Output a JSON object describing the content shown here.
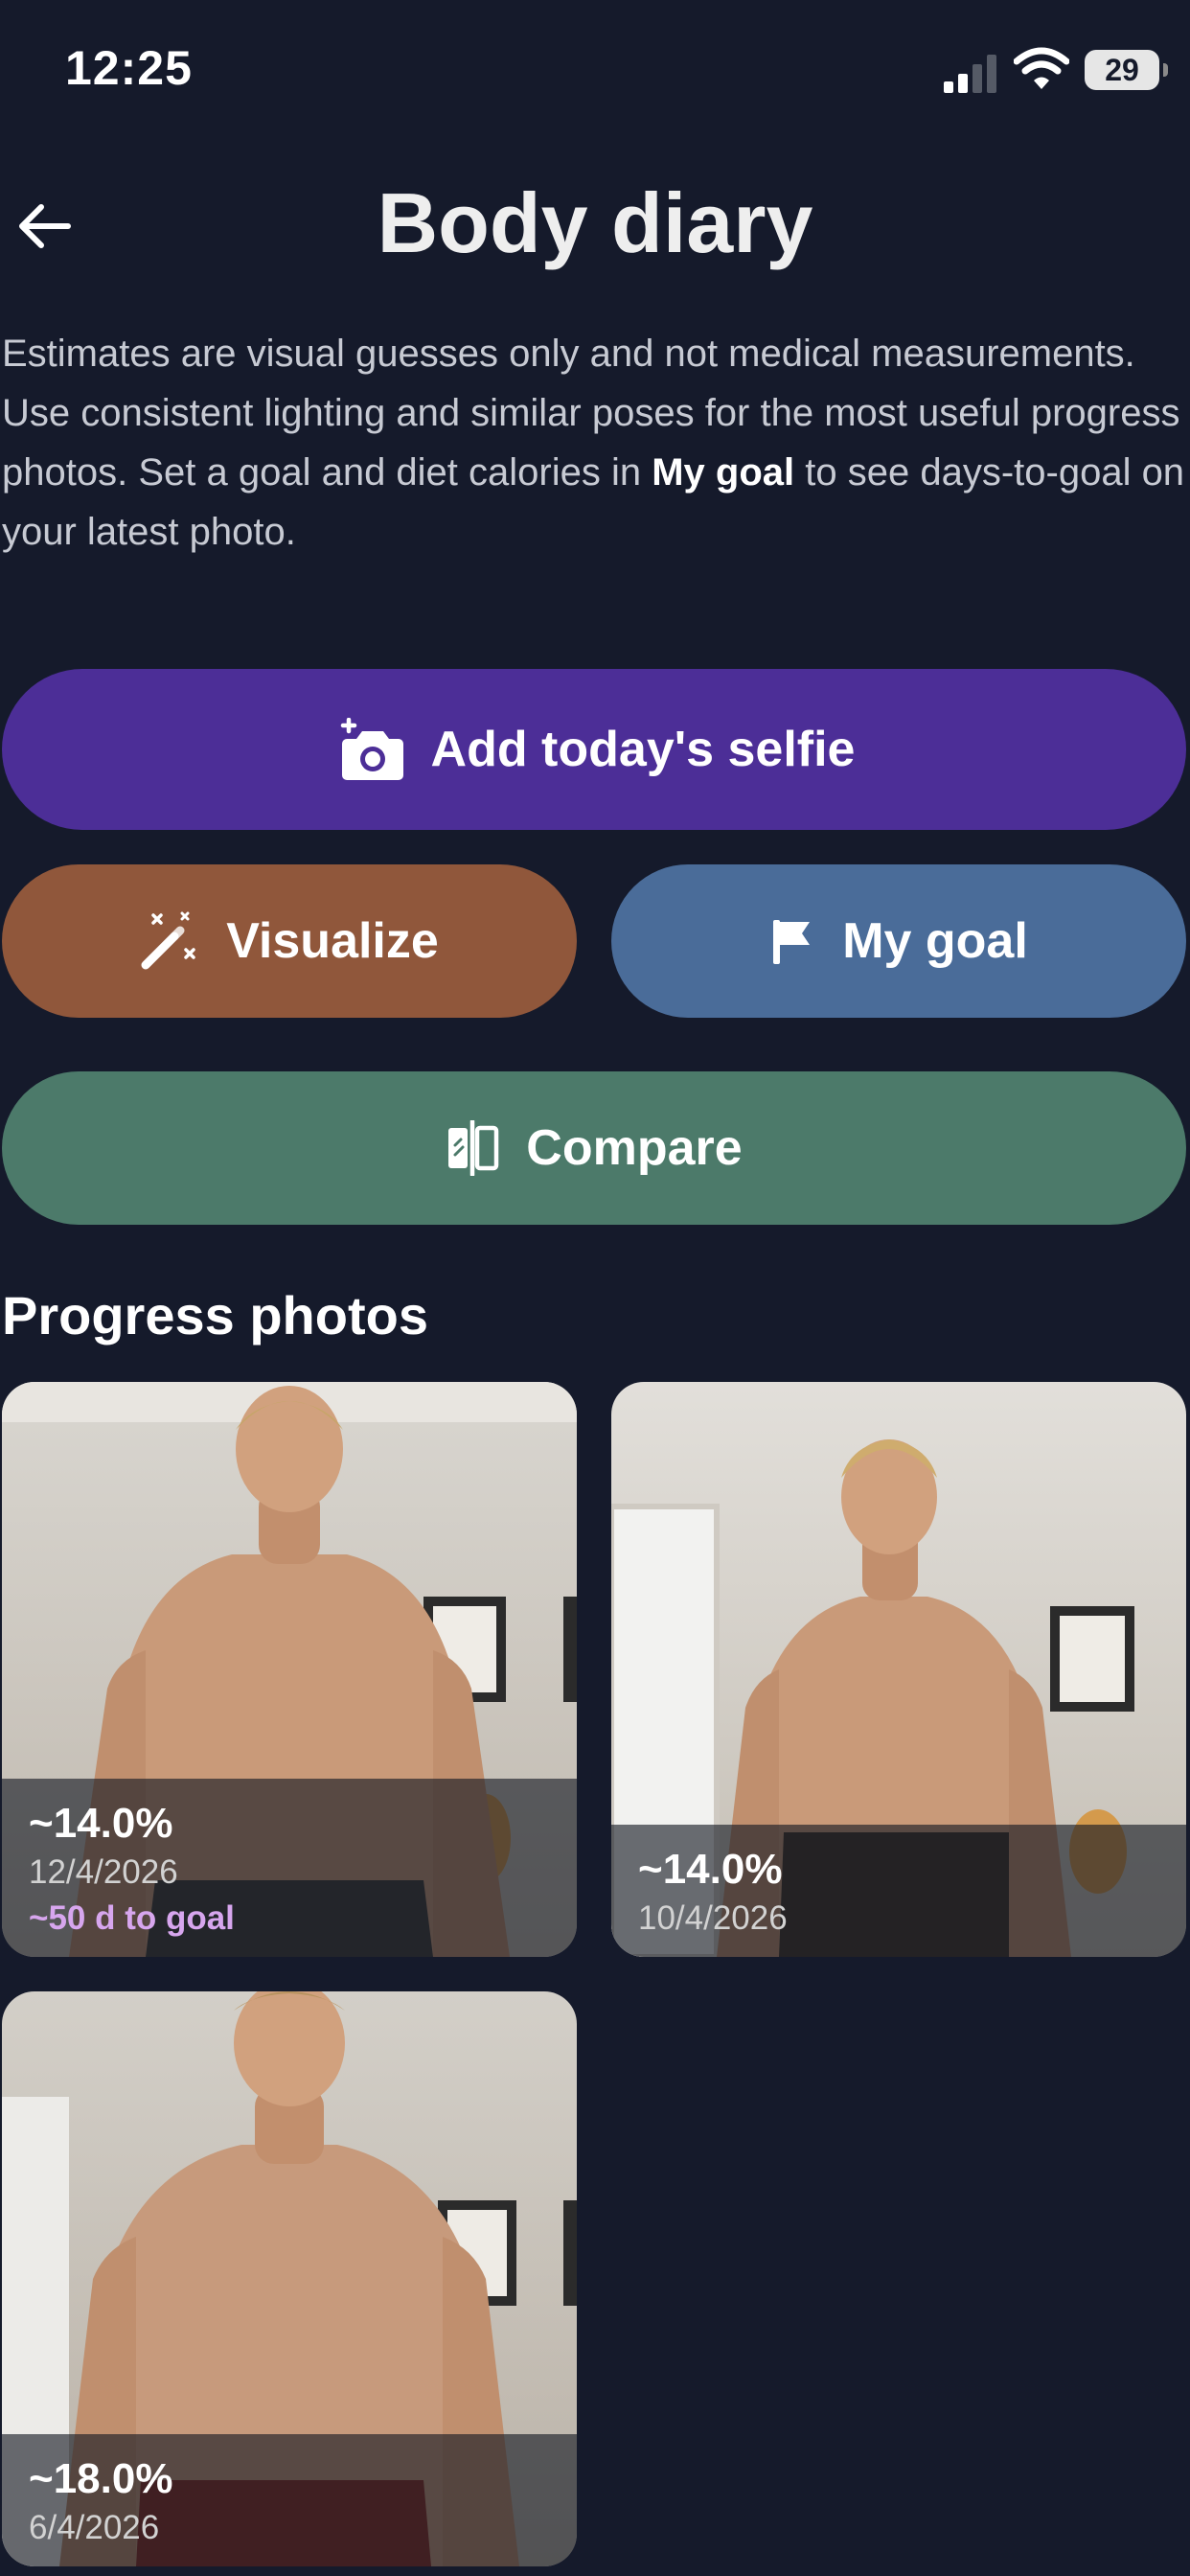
{
  "status_bar": {
    "time": "12:25",
    "battery": "29",
    "icons": [
      "signal-icon",
      "wifi-icon",
      "battery-icon"
    ]
  },
  "header": {
    "back_icon": "arrow-left-icon",
    "title": "Body diary"
  },
  "disclaimer": {
    "part1": "Estimates are visual guesses only and not medical measurements. Use consistent lighting and similar poses for the most useful progress photos. Set a goal and diet calories in ",
    "bold": "My goal",
    "part2": " to see days-to-goal on your latest photo."
  },
  "actions": {
    "add_selfie": {
      "label": "Add today's selfie",
      "icon": "camera-plus-icon",
      "color": "#4c2e97"
    },
    "visualize": {
      "label": "Visualize",
      "icon": "magic-wand-icon",
      "color": "#90573b"
    },
    "my_goal": {
      "label": "My goal",
      "icon": "flag-icon",
      "color": "#4a6c99"
    },
    "compare": {
      "label": "Compare",
      "icon": "compare-icon",
      "color": "#4c7a6a"
    }
  },
  "progress": {
    "title": "Progress photos",
    "photos": [
      {
        "body_fat": "~14.0%",
        "date": "12/4/2026",
        "goal": "~50 d to goal"
      },
      {
        "body_fat": "~14.0%",
        "date": "10/4/2026"
      },
      {
        "body_fat": "~18.0%",
        "date": "6/4/2026"
      }
    ]
  },
  "colors": {
    "background": "#151a2b",
    "goal_text": "#d7a6ee"
  }
}
